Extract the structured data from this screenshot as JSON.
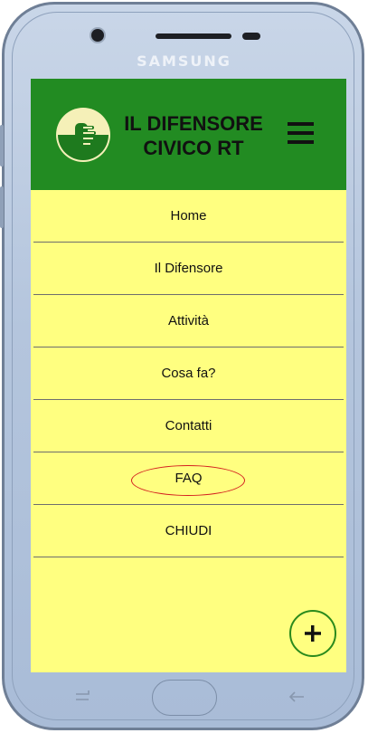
{
  "device": {
    "brand": "SAMSUNG"
  },
  "app": {
    "title_line1": "IL DIFENSORE",
    "title_line2": "CIVICO RT",
    "header_color": "#228b22",
    "background_color": "#ffff80"
  },
  "menu": {
    "items": [
      {
        "label": "Home"
      },
      {
        "label": "Il Difensore"
      },
      {
        "label": "Attività"
      },
      {
        "label": "Cosa fa?"
      },
      {
        "label": "Contatti"
      },
      {
        "label": "FAQ",
        "highlighted": true
      },
      {
        "label": "CHIUDI"
      }
    ]
  },
  "fab": {
    "icon": "plus-icon"
  },
  "annotation": {
    "color": "#d42020"
  }
}
